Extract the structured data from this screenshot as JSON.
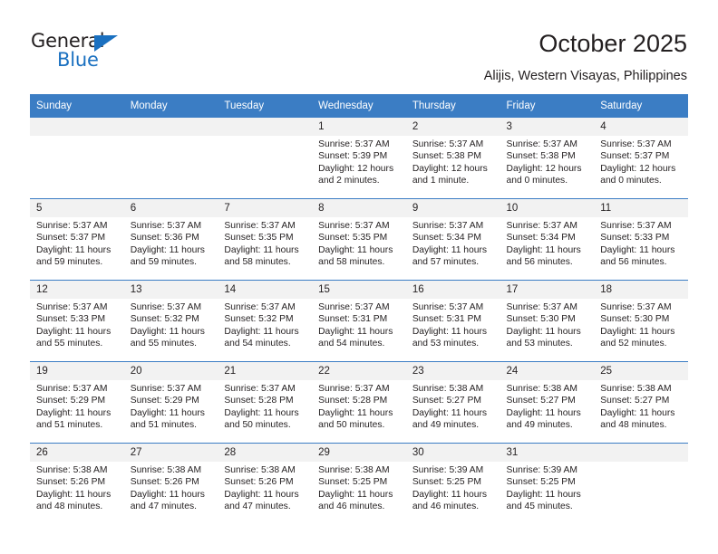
{
  "branding": {
    "logo_primary": "General",
    "logo_secondary": "Blue",
    "logo_icon": "triangle-mark",
    "accent_color": "#1a70c0"
  },
  "header": {
    "title": "October 2025",
    "subtitle": "Alijis, Western Visayas, Philippines"
  },
  "calendar": {
    "header_bg": "#3b7dc4",
    "daynum_bg": "#f2f2f2",
    "weekday_headers": [
      "Sunday",
      "Monday",
      "Tuesday",
      "Wednesday",
      "Thursday",
      "Friday",
      "Saturday"
    ],
    "weeks": [
      [
        {
          "day": "",
          "empty": true
        },
        {
          "day": "",
          "empty": true
        },
        {
          "day": "",
          "empty": true
        },
        {
          "day": "1",
          "sunrise": "Sunrise: 5:37 AM",
          "sunset": "Sunset: 5:39 PM",
          "daylight": "Daylight: 12 hours and 2 minutes."
        },
        {
          "day": "2",
          "sunrise": "Sunrise: 5:37 AM",
          "sunset": "Sunset: 5:38 PM",
          "daylight": "Daylight: 12 hours and 1 minute."
        },
        {
          "day": "3",
          "sunrise": "Sunrise: 5:37 AM",
          "sunset": "Sunset: 5:38 PM",
          "daylight": "Daylight: 12 hours and 0 minutes."
        },
        {
          "day": "4",
          "sunrise": "Sunrise: 5:37 AM",
          "sunset": "Sunset: 5:37 PM",
          "daylight": "Daylight: 12 hours and 0 minutes."
        }
      ],
      [
        {
          "day": "5",
          "sunrise": "Sunrise: 5:37 AM",
          "sunset": "Sunset: 5:37 PM",
          "daylight": "Daylight: 11 hours and 59 minutes."
        },
        {
          "day": "6",
          "sunrise": "Sunrise: 5:37 AM",
          "sunset": "Sunset: 5:36 PM",
          "daylight": "Daylight: 11 hours and 59 minutes."
        },
        {
          "day": "7",
          "sunrise": "Sunrise: 5:37 AM",
          "sunset": "Sunset: 5:35 PM",
          "daylight": "Daylight: 11 hours and 58 minutes."
        },
        {
          "day": "8",
          "sunrise": "Sunrise: 5:37 AM",
          "sunset": "Sunset: 5:35 PM",
          "daylight": "Daylight: 11 hours and 58 minutes."
        },
        {
          "day": "9",
          "sunrise": "Sunrise: 5:37 AM",
          "sunset": "Sunset: 5:34 PM",
          "daylight": "Daylight: 11 hours and 57 minutes."
        },
        {
          "day": "10",
          "sunrise": "Sunrise: 5:37 AM",
          "sunset": "Sunset: 5:34 PM",
          "daylight": "Daylight: 11 hours and 56 minutes."
        },
        {
          "day": "11",
          "sunrise": "Sunrise: 5:37 AM",
          "sunset": "Sunset: 5:33 PM",
          "daylight": "Daylight: 11 hours and 56 minutes."
        }
      ],
      [
        {
          "day": "12",
          "sunrise": "Sunrise: 5:37 AM",
          "sunset": "Sunset: 5:33 PM",
          "daylight": "Daylight: 11 hours and 55 minutes."
        },
        {
          "day": "13",
          "sunrise": "Sunrise: 5:37 AM",
          "sunset": "Sunset: 5:32 PM",
          "daylight": "Daylight: 11 hours and 55 minutes."
        },
        {
          "day": "14",
          "sunrise": "Sunrise: 5:37 AM",
          "sunset": "Sunset: 5:32 PM",
          "daylight": "Daylight: 11 hours and 54 minutes."
        },
        {
          "day": "15",
          "sunrise": "Sunrise: 5:37 AM",
          "sunset": "Sunset: 5:31 PM",
          "daylight": "Daylight: 11 hours and 54 minutes."
        },
        {
          "day": "16",
          "sunrise": "Sunrise: 5:37 AM",
          "sunset": "Sunset: 5:31 PM",
          "daylight": "Daylight: 11 hours and 53 minutes."
        },
        {
          "day": "17",
          "sunrise": "Sunrise: 5:37 AM",
          "sunset": "Sunset: 5:30 PM",
          "daylight": "Daylight: 11 hours and 53 minutes."
        },
        {
          "day": "18",
          "sunrise": "Sunrise: 5:37 AM",
          "sunset": "Sunset: 5:30 PM",
          "daylight": "Daylight: 11 hours and 52 minutes."
        }
      ],
      [
        {
          "day": "19",
          "sunrise": "Sunrise: 5:37 AM",
          "sunset": "Sunset: 5:29 PM",
          "daylight": "Daylight: 11 hours and 51 minutes."
        },
        {
          "day": "20",
          "sunrise": "Sunrise: 5:37 AM",
          "sunset": "Sunset: 5:29 PM",
          "daylight": "Daylight: 11 hours and 51 minutes."
        },
        {
          "day": "21",
          "sunrise": "Sunrise: 5:37 AM",
          "sunset": "Sunset: 5:28 PM",
          "daylight": "Daylight: 11 hours and 50 minutes."
        },
        {
          "day": "22",
          "sunrise": "Sunrise: 5:37 AM",
          "sunset": "Sunset: 5:28 PM",
          "daylight": "Daylight: 11 hours and 50 minutes."
        },
        {
          "day": "23",
          "sunrise": "Sunrise: 5:38 AM",
          "sunset": "Sunset: 5:27 PM",
          "daylight": "Daylight: 11 hours and 49 minutes."
        },
        {
          "day": "24",
          "sunrise": "Sunrise: 5:38 AM",
          "sunset": "Sunset: 5:27 PM",
          "daylight": "Daylight: 11 hours and 49 minutes."
        },
        {
          "day": "25",
          "sunrise": "Sunrise: 5:38 AM",
          "sunset": "Sunset: 5:27 PM",
          "daylight": "Daylight: 11 hours and 48 minutes."
        }
      ],
      [
        {
          "day": "26",
          "sunrise": "Sunrise: 5:38 AM",
          "sunset": "Sunset: 5:26 PM",
          "daylight": "Daylight: 11 hours and 48 minutes."
        },
        {
          "day": "27",
          "sunrise": "Sunrise: 5:38 AM",
          "sunset": "Sunset: 5:26 PM",
          "daylight": "Daylight: 11 hours and 47 minutes."
        },
        {
          "day": "28",
          "sunrise": "Sunrise: 5:38 AM",
          "sunset": "Sunset: 5:26 PM",
          "daylight": "Daylight: 11 hours and 47 minutes."
        },
        {
          "day": "29",
          "sunrise": "Sunrise: 5:38 AM",
          "sunset": "Sunset: 5:25 PM",
          "daylight": "Daylight: 11 hours and 46 minutes."
        },
        {
          "day": "30",
          "sunrise": "Sunrise: 5:39 AM",
          "sunset": "Sunset: 5:25 PM",
          "daylight": "Daylight: 11 hours and 46 minutes."
        },
        {
          "day": "31",
          "sunrise": "Sunrise: 5:39 AM",
          "sunset": "Sunset: 5:25 PM",
          "daylight": "Daylight: 11 hours and 45 minutes."
        },
        {
          "day": "",
          "empty": true
        }
      ]
    ]
  }
}
